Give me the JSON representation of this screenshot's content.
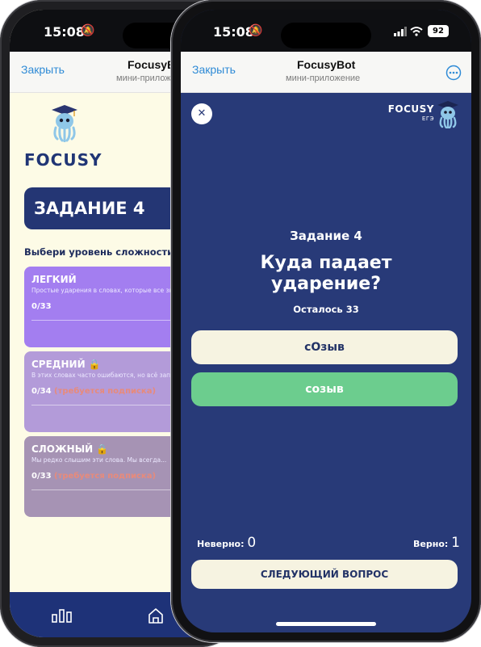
{
  "status": {
    "time": "15:08",
    "battery": "92"
  },
  "back_screen": {
    "close_label": "Закрыть",
    "title": "FocusyBot",
    "subtitle": "мини-приложение",
    "logo_text": "FOCUSY",
    "task_banner": "ЗАДАНИЕ 4",
    "choose_level": "Выбери уровень сложности",
    "levels": [
      {
        "name": "ЛЕГКИЙ",
        "desc": "Простые ударения в словах, которые все знают",
        "count": "0/33",
        "sub": "",
        "color": "#a37ef0"
      },
      {
        "name": "СРЕДНИЙ",
        "desc": "В этих словах часто ошибаются, но всё запомнить",
        "count": "0/34",
        "sub": "(требуется подписка)",
        "color": "#b39bd9"
      },
      {
        "name": "СЛОЖНЫЙ",
        "desc": "Мы редко слышим эти слова. Мы всегда...",
        "count": "0/33",
        "sub": "(требуется подписка)",
        "color": "#a693b4"
      }
    ],
    "nav": [
      "stats-icon",
      "home-icon"
    ]
  },
  "front_screen": {
    "close_label": "Закрыть",
    "title": "FocusyBot",
    "subtitle": "мини-приложение",
    "brand_name": "FOCUSY",
    "brand_sub": "ЕГЭ",
    "task_label": "Задание 4",
    "question_line1": "Куда падает",
    "question_line2": "ударение?",
    "remaining": "Осталось 33",
    "options": [
      "сОзыв",
      "созыв"
    ],
    "wrong_label": "Неверно:",
    "wrong_value": "0",
    "right_label": "Верно:",
    "right_value": "1",
    "next_button": "СЛЕДУЮЩИЙ ВОПРОС"
  },
  "colors": {
    "accent": "#283a78",
    "correct": "#6ccd8e",
    "cream": "#f6f3e1",
    "link": "#2f8bd6"
  }
}
